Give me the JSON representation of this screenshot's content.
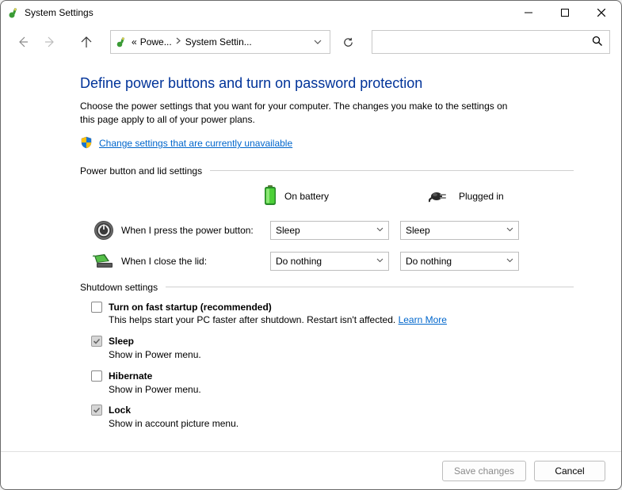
{
  "window": {
    "title": "System Settings"
  },
  "breadcrumb": {
    "prefix": "«",
    "item1": "Powe...",
    "item2": "System Settin..."
  },
  "search": {
    "placeholder": ""
  },
  "main": {
    "heading": "Define power buttons and turn on password protection",
    "subtext": "Choose the power settings that you want for your computer. The changes you make to the settings on this page apply to all of your power plans.",
    "change_link": "Change settings that are currently unavailable",
    "section1": "Power button and lid settings",
    "col_battery": "On battery",
    "col_plugged": "Plugged in",
    "row_power_label": "When I press the power button:",
    "row_power_battery": "Sleep",
    "row_power_plugged": "Sleep",
    "row_lid_label": "When I close the lid:",
    "row_lid_battery": "Do nothing",
    "row_lid_plugged": "Do nothing",
    "section2": "Shutdown settings",
    "items": [
      {
        "title": "Turn on fast startup (recommended)",
        "desc": "This helps start your PC faster after shutdown. Restart isn't affected. ",
        "learn": "Learn More",
        "checked": false
      },
      {
        "title": "Sleep",
        "desc": "Show in Power menu.",
        "learn": "",
        "checked": true
      },
      {
        "title": "Hibernate",
        "desc": "Show in Power menu.",
        "learn": "",
        "checked": false
      },
      {
        "title": "Lock",
        "desc": "Show in account picture menu.",
        "learn": "",
        "checked": true
      }
    ]
  },
  "footer": {
    "save": "Save changes",
    "cancel": "Cancel"
  }
}
